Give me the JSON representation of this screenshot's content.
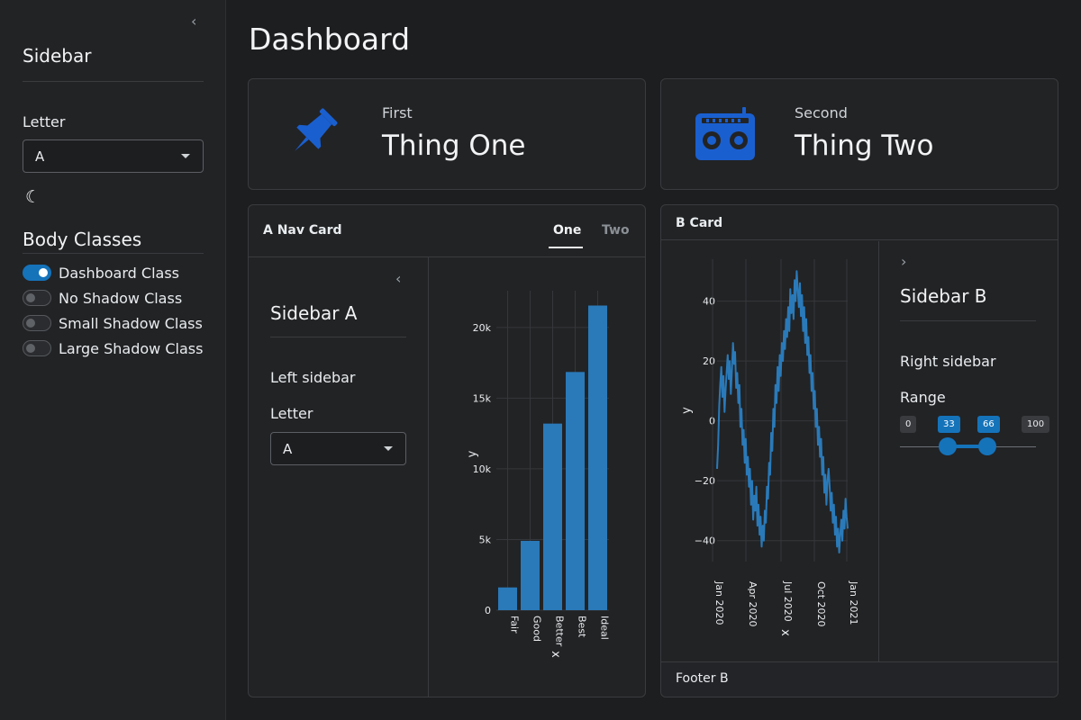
{
  "sidebar": {
    "collapse_icon": "chevron-left-icon",
    "title": "Sidebar",
    "letter_label": "Letter",
    "letter_value": "A",
    "dark_mode_icon": "moon-icon",
    "body_classes_title": "Body Classes",
    "toggles": [
      {
        "label": "Dashboard Class",
        "on": true
      },
      {
        "label": "No Shadow Class",
        "on": false
      },
      {
        "label": "Small Shadow Class",
        "on": false
      },
      {
        "label": "Large Shadow Class",
        "on": false
      }
    ]
  },
  "main": {
    "title": "Dashboard",
    "value_boxes": [
      {
        "label": "First",
        "value": "Thing One",
        "icon": "pushpin-icon"
      },
      {
        "label": "Second",
        "value": "Thing Two",
        "icon": "boombox-icon"
      }
    ],
    "nav_card": {
      "title": "A Nav Card",
      "tabs": [
        {
          "label": "One",
          "active": true
        },
        {
          "label": "Two",
          "active": false
        }
      ],
      "sidebar": {
        "title": "Sidebar A",
        "text": "Left sidebar",
        "letter_label": "Letter",
        "letter_value": "A"
      }
    },
    "b_card": {
      "title": "B Card",
      "footer": "Footer B",
      "sidebar": {
        "title": "Sidebar B",
        "text": "Right sidebar",
        "range_label": "Range",
        "range_min": 0,
        "range_max": 100,
        "range_value": [
          33,
          66
        ]
      }
    }
  },
  "colors": {
    "accent": "#1573ba",
    "bar": "#2a7ab9",
    "line": "#2a7ab9",
    "icon": "#1a5fcf"
  },
  "chart_data": [
    {
      "type": "bar",
      "categories": [
        "Fair",
        "Good",
        "Better",
        "Best",
        "Ideal"
      ],
      "values": [
        1610,
        4906,
        13200,
        16850,
        21550
      ],
      "xlabel": "x",
      "ylabel": "y",
      "yticks": [
        0,
        5000,
        10000,
        15000,
        20000
      ],
      "ytick_labels": [
        "0",
        "5k",
        "10k",
        "15k",
        "20k"
      ],
      "ylim": [
        0,
        22600
      ],
      "grid": true
    },
    {
      "type": "line",
      "x_start": "2020-01-01",
      "x_end": "2020-12-31",
      "xticks": [
        "Jan 2020",
        "Apr 2020",
        "Jul 2020",
        "Oct 2020",
        "Jan 2021"
      ],
      "xlabel": "x",
      "ylabel": "y",
      "yticks": [
        -40,
        -20,
        0,
        20,
        40
      ],
      "ylim": [
        -47,
        54
      ],
      "grid": true,
      "y": [
        -16,
        -8,
        5,
        12,
        18,
        8,
        15,
        3,
        10,
        16,
        22,
        14,
        20,
        9,
        17,
        26,
        19,
        23,
        11,
        16,
        6,
        12,
        -2,
        4,
        -8,
        -3,
        -14,
        -6,
        -18,
        -12,
        -22,
        -16,
        -28,
        -20,
        -33,
        -25,
        -30,
        -22,
        -35,
        -28,
        -38,
        -32,
        -42,
        -35,
        -40,
        -30,
        -34,
        -22,
        -26,
        -14,
        -18,
        -4,
        -10,
        4,
        -2,
        12,
        6,
        18,
        10,
        22,
        15,
        26,
        20,
        30,
        24,
        34,
        28,
        38,
        30,
        44,
        36,
        42,
        34,
        47,
        40,
        50,
        44,
        38,
        46,
        35,
        42,
        30,
        38,
        26,
        34,
        22,
        28,
        16,
        22,
        10,
        16,
        4,
        10,
        -2,
        4,
        -8,
        -2,
        -12,
        -6,
        -18,
        -12,
        -24,
        -18,
        -28,
        -20,
        -16,
        -22,
        -30,
        -24,
        -34,
        -28,
        -38,
        -32,
        -42,
        -36,
        -44,
        -38,
        -33,
        -40,
        -30,
        -36,
        -26,
        -32,
        -36
      ]
    }
  ]
}
